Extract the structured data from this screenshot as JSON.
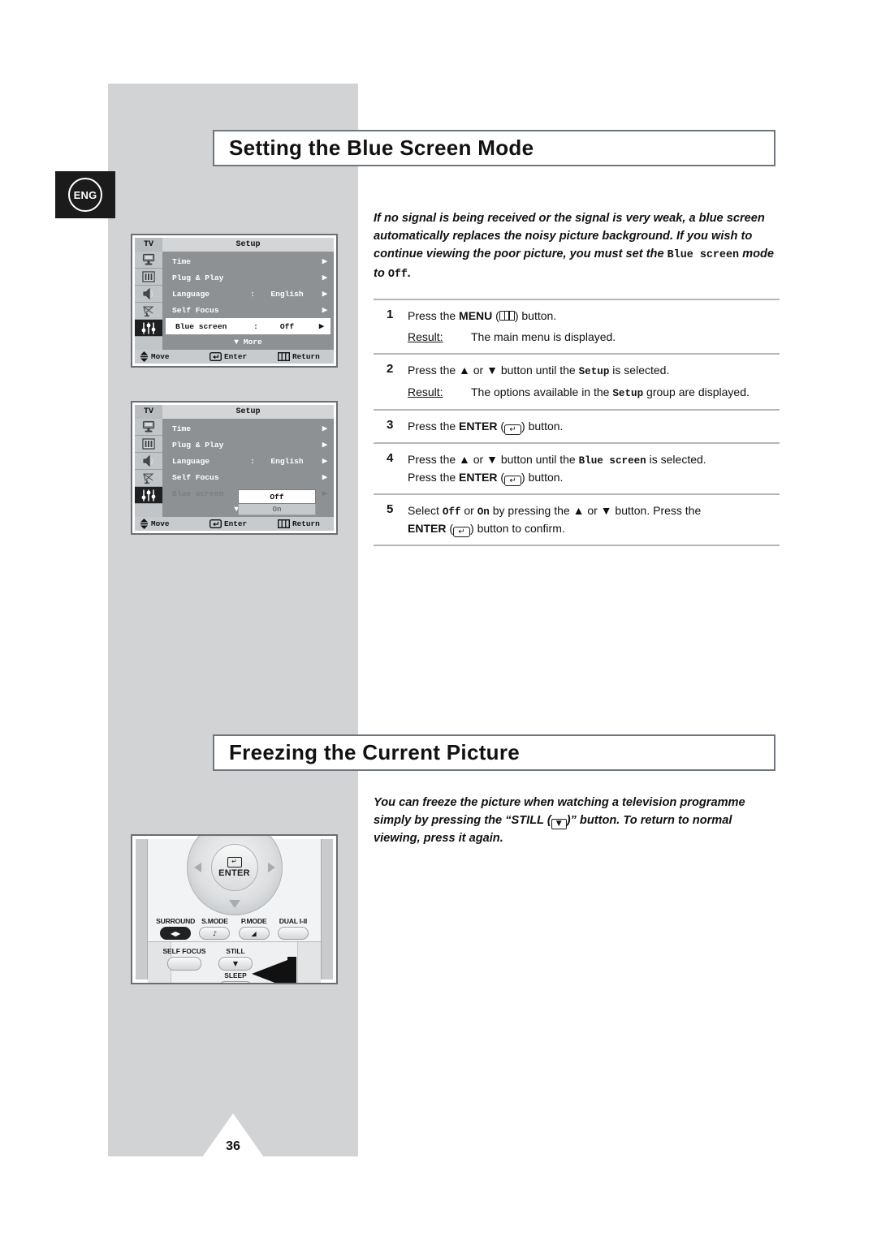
{
  "page": {
    "language_badge": "ENG",
    "page_number": "36"
  },
  "sections": [
    {
      "title": "Setting the Blue Screen Mode",
      "intro": {
        "part1": "If no signal is being received or the signal is very weak, a blue screen automatically replaces the noisy picture background. If you wish to continue viewing the poor picture, you must set the ",
        "mono1": "Blue screen",
        "part2": " mode to ",
        "mono2": "Off",
        "part3": "."
      },
      "steps": [
        {
          "num": "1",
          "text_before": "Press the ",
          "bold": "MENU",
          "icon": "menu-icon",
          "text_after": " button.",
          "result_label": "Result:",
          "result_text": "The main menu is displayed."
        },
        {
          "num": "2",
          "text_before": "Press the ▲ or ▼ button until the ",
          "mono": "Setup",
          "text_after": " is selected.",
          "result_label": "Result:",
          "result_before": "The options available in the ",
          "result_mono": "Setup",
          "result_after": " group are displayed."
        },
        {
          "num": "3",
          "text_before": "Press the ",
          "bold": "ENTER",
          "icon": "enter-icon",
          "text_after": " button."
        },
        {
          "num": "4",
          "line1_before": "Press the ▲ or ▼ button until the ",
          "line1_mono": "Blue screen",
          "line1_after": " is selected.",
          "line2_before": "Press the ",
          "line2_bold": "ENTER",
          "line2_icon": "enter-icon",
          "line2_after": " button."
        },
        {
          "num": "5",
          "line1_before": "Select ",
          "line1_mono1": "Off",
          "line1_mid": " or ",
          "line1_mono2": "On",
          "line1_after": "  by pressing the ▲ or ▼ button. Press the",
          "line2_bold": "ENTER",
          "line2_icon": "enter-icon",
          "line2_after": " button to confirm."
        }
      ]
    },
    {
      "title": "Freezing the Current Picture",
      "intro": {
        "part1": "You can freeze the picture when watching a television programme simply by pressing the “STILL (",
        "icon": "down-arrow-icon",
        "part2": ")” button. To return to normal viewing, press it again."
      }
    }
  ],
  "osd_menus": [
    {
      "tv_label": "TV",
      "title": "Setup",
      "icons": [
        "clock-icon",
        "picture-bars-icon",
        "speaker-icon",
        "satellite-dish-icon",
        "setup-sliders-icon"
      ],
      "rows": [
        {
          "label": "Time",
          "colon": "",
          "value": "",
          "arrow": "▶",
          "state": "normal"
        },
        {
          "label": "Plug & Play",
          "colon": "",
          "value": "",
          "arrow": "▶",
          "state": "normal"
        },
        {
          "label": "Language",
          "colon": ":",
          "value": "English",
          "arrow": "▶",
          "state": "normal"
        },
        {
          "label": "Self Focus",
          "colon": "",
          "value": "",
          "arrow": "▶",
          "state": "normal"
        },
        {
          "label": "Blue screen",
          "colon": ":",
          "value": "Off",
          "arrow": "▶",
          "state": "selected"
        }
      ],
      "more": "▼ More",
      "bottom": [
        {
          "icon": "updown-arrows-icon",
          "label": "Move"
        },
        {
          "icon": "enter-icon",
          "label": "Enter"
        },
        {
          "icon": "menu-icon",
          "label": "Return"
        }
      ],
      "dropdown": null
    },
    {
      "tv_label": "TV",
      "title": "Setup",
      "icons": [
        "clock-icon",
        "picture-bars-icon",
        "speaker-icon",
        "satellite-dish-icon",
        "setup-sliders-icon"
      ],
      "rows": [
        {
          "label": "Time",
          "colon": "",
          "value": "",
          "arrow": "▶",
          "state": "normal"
        },
        {
          "label": "Plug & Play",
          "colon": "",
          "value": "",
          "arrow": "▶",
          "state": "normal"
        },
        {
          "label": "Language",
          "colon": ":",
          "value": "English",
          "arrow": "▶",
          "state": "normal"
        },
        {
          "label": "Self Focus",
          "colon": "",
          "value": "",
          "arrow": "▶",
          "state": "normal"
        },
        {
          "label": "Blue screen",
          "colon": ":",
          "value": "",
          "arrow": "▶",
          "state": "dim"
        }
      ],
      "more": "▼ More",
      "bottom": [
        {
          "icon": "updown-arrows-icon",
          "label": "Move"
        },
        {
          "icon": "enter-icon",
          "label": "Enter"
        },
        {
          "icon": "menu-icon",
          "label": "Return"
        }
      ],
      "dropdown": {
        "selected": "Off",
        "other": "On"
      }
    }
  ],
  "remote": {
    "enter_label": "ENTER",
    "buttons_row": [
      {
        "label": "SURROUND",
        "glyph": "◀▶",
        "style": "dark"
      },
      {
        "label": "S.MODE",
        "glyph": "♪",
        "style": "light"
      },
      {
        "label": "P.MODE",
        "glyph": "◢",
        "style": "light"
      },
      {
        "label": "DUAL I-II",
        "glyph": "",
        "style": "light"
      }
    ],
    "lower_buttons": [
      {
        "label": "SELF FOCUS",
        "glyph": ""
      },
      {
        "label": "STILL",
        "glyph": "▼"
      },
      {
        "label": "SLEEP",
        "glyph": "⏱"
      }
    ]
  }
}
